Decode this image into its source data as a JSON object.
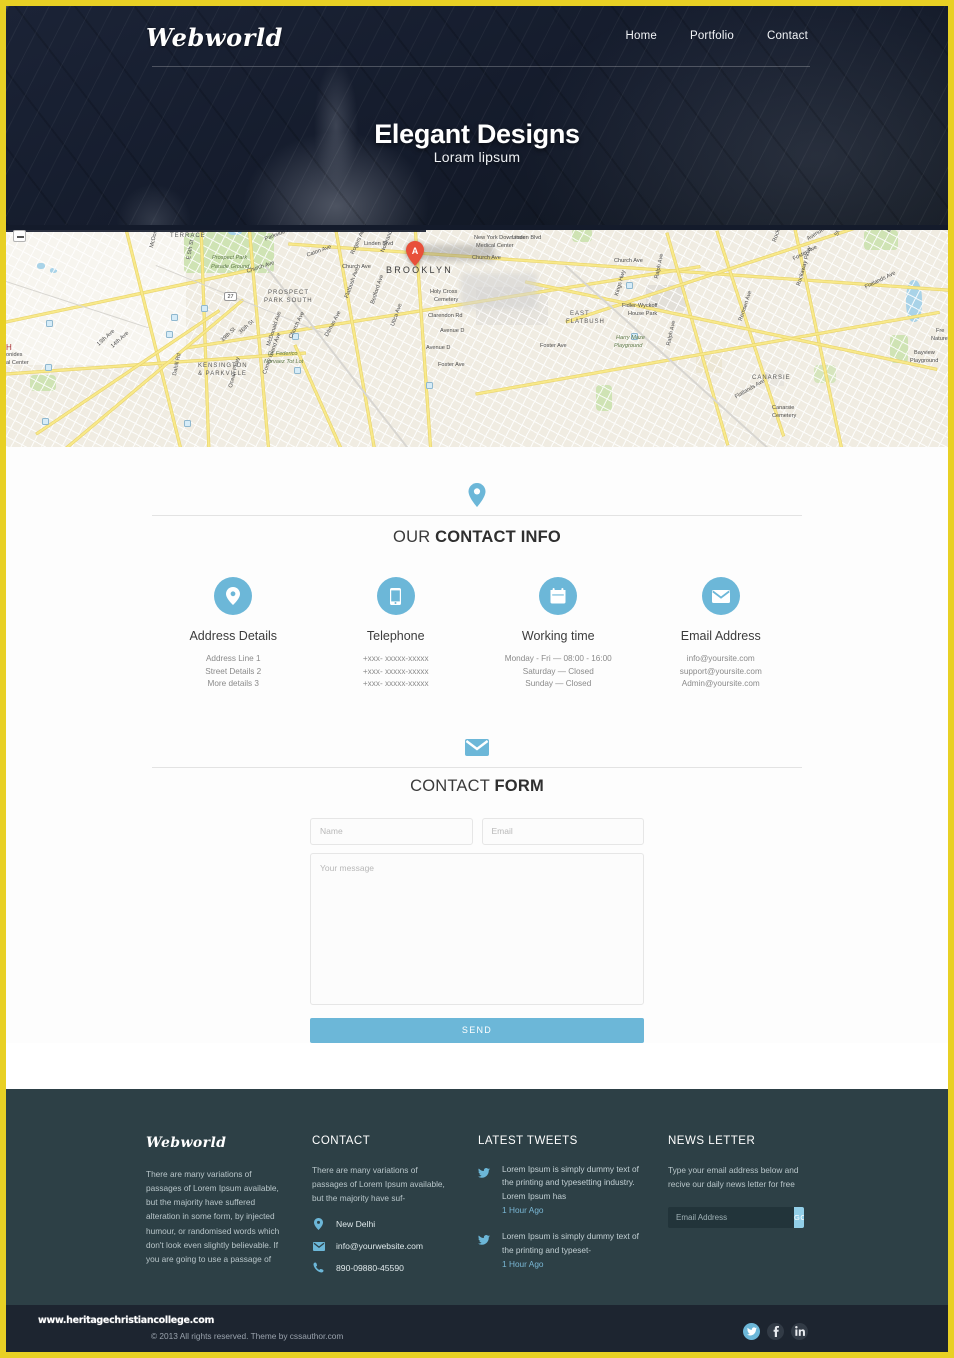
{
  "theme": {
    "border_color": "#e8d024",
    "accent": "#6cb7d8",
    "hero_bg": "#171f30",
    "footer_bg": "#2d4046",
    "bottombar_bg": "#1d2530"
  },
  "header": {
    "brand": "Webworld",
    "nav": [
      {
        "label": "Home"
      },
      {
        "label": "Portfolio"
      },
      {
        "label": "Contact"
      }
    ]
  },
  "hero": {
    "title": "Elegant Designs",
    "subtitle": "Loram lipsum"
  },
  "map": {
    "marker_letter": "A",
    "labels": [
      "TERRACE",
      "Parkside Ave",
      "Caton Ave",
      "Linden Blvd",
      "Church Ave",
      "New York Downstate",
      "Medical Center",
      "BROOKLYN",
      "Prospect Park",
      "Parade Ground",
      "Rockaway Ave",
      "Avenue L",
      "E 5th St",
      "McDonald Ave",
      "27",
      "Church Ave",
      "PROSPECT",
      "PARK SOUTH",
      "Flatbush Ave",
      "Rogers Ave",
      "Nostrand Ave",
      "Holy Cross",
      "Cemetery",
      "Ralph Ave",
      "Fidler-Wyckoff",
      "House Park",
      "Clarendon Rd",
      "EAST",
      "FLATBUSH",
      "Avenue D",
      "Harry Maze",
      "Playground",
      "Remsen Ave",
      "Rockaway Pkwy",
      "CANARSIE",
      "Foster Ave",
      "36th St",
      "39th St",
      "13th Ave",
      "14th Ave",
      "Bedford Ave",
      "Ditmas Ave",
      "Lt. Federico",
      "Narvaez Tot Lot",
      "KENSINGTON",
      "& PARKVILLE",
      "Dahill Rd",
      "Ocean Pkwy",
      "Coney Island Ave",
      "Utica Ave",
      "Kings Hwy",
      "Flatlands Ave",
      "Canarsie",
      "Cemetery",
      "Bayview",
      "Playground",
      "Fre",
      "Nature",
      "Maimonides",
      "Medical Center",
      "H"
    ]
  },
  "contact_info": {
    "heading_light": "OUR ",
    "heading_bold": "CONTACT INFO",
    "items": [
      {
        "icon": "map-pin-icon",
        "title": "Address Details",
        "lines": [
          "Address Line 1",
          "Street Details 2",
          "More details 3"
        ]
      },
      {
        "icon": "phone-icon",
        "title": "Telephone",
        "lines": [
          "+xxx- xxxxx-xxxxx",
          "+xxx- xxxxx-xxxxx",
          "+xxx- xxxxx-xxxxx"
        ]
      },
      {
        "icon": "calendar-icon",
        "title": "Working time",
        "lines": [
          "Monday - Fri — 08:00 - 16:00",
          "Saturday — Closed",
          "Sunday — Closed"
        ]
      },
      {
        "icon": "envelope-icon",
        "title": "Email Address",
        "lines": [
          "info@yoursite.com",
          "support@yoursite.com",
          "Admin@yoursite.com"
        ]
      }
    ]
  },
  "contact_form": {
    "heading_light": "CONTACT ",
    "heading_bold": "FORM",
    "name_placeholder": "Name",
    "name_value": "",
    "email_placeholder": "Email",
    "email_value": "",
    "message_placeholder": "Your message",
    "message_value": "",
    "send_label": "SEND"
  },
  "footer": {
    "about": {
      "brand": "Webworld",
      "text": "There are many variations of passages of Lorem Ipsum available, but the majority have suffered alteration in some form, by injected humour, or randomised words which don't look even slightly believable. If you are going to use a passage of"
    },
    "contact": {
      "heading": "CONTACT",
      "text": "There are many variations of passages of Lorem Ipsum available, but the majority have suf-",
      "items": [
        {
          "icon": "map-pin-icon",
          "text": "New Delhi"
        },
        {
          "icon": "envelope-icon",
          "text": "info@yourwebsite.com"
        },
        {
          "icon": "phone-icon",
          "text": "890-09880-45590"
        }
      ]
    },
    "tweets": {
      "heading": "LATEST TWEETS",
      "items": [
        {
          "icon": "twitter-icon",
          "text": "Lorem Ipsum is simply dummy text of the printing and typesetting industry. Lorem Ipsum has",
          "ago": "1 Hour Ago"
        },
        {
          "icon": "twitter-icon",
          "text": "Lorem Ipsum is simply dummy text of the printing and typeset-",
          "ago": "1 Hour Ago"
        }
      ]
    },
    "newsletter": {
      "heading": "NEWS LETTER",
      "text": "Type your email address below and recive our daily news letter for free",
      "input_placeholder": "Email Address",
      "input_value": "",
      "go_label": "GO"
    }
  },
  "bottom_bar": {
    "watermark": "www.heritagechristiancollege.com",
    "copyright": "© 2013 All rights reserved.  Theme by cssauthor.com",
    "socials": [
      {
        "icon": "twitter-icon",
        "name": "twitter"
      },
      {
        "icon": "facebook-icon",
        "name": "facebook"
      },
      {
        "icon": "linkedin-icon",
        "name": "linkedin"
      }
    ]
  }
}
